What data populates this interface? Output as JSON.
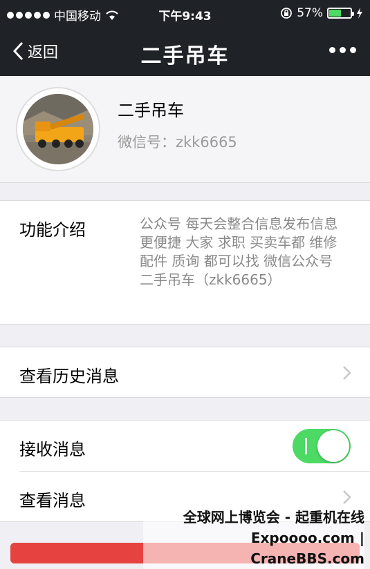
{
  "status_bar": {
    "carrier": "中国移动",
    "time": "下午9:43",
    "battery_percent": "57%",
    "battery_level": 0.57
  },
  "nav": {
    "back_label": "返回",
    "title": "二手吊车"
  },
  "profile": {
    "name": "二手吊车",
    "wechat_id": "微信号：zkk6665"
  },
  "intro": {
    "label": "功能介绍",
    "text": "公众号 每天会整合信息发布信息更便捷 大家 求职 买卖车都 维修 配件 质询 都可以找 微信公众号 二手吊车（zkk6665）"
  },
  "history": {
    "label": "查看历史消息"
  },
  "messages": {
    "receive_label": "接收消息",
    "receive_enabled": true,
    "view_label": "查看消息"
  },
  "watermark": {
    "line1": "全球网上博览会 - 起重机在线",
    "line2": "Expoooo.com | CraneBBS.com"
  },
  "colors": {
    "nav_bg": "#1f2327",
    "toggle_on": "#4cd964",
    "bottom_button": "#e64340"
  }
}
